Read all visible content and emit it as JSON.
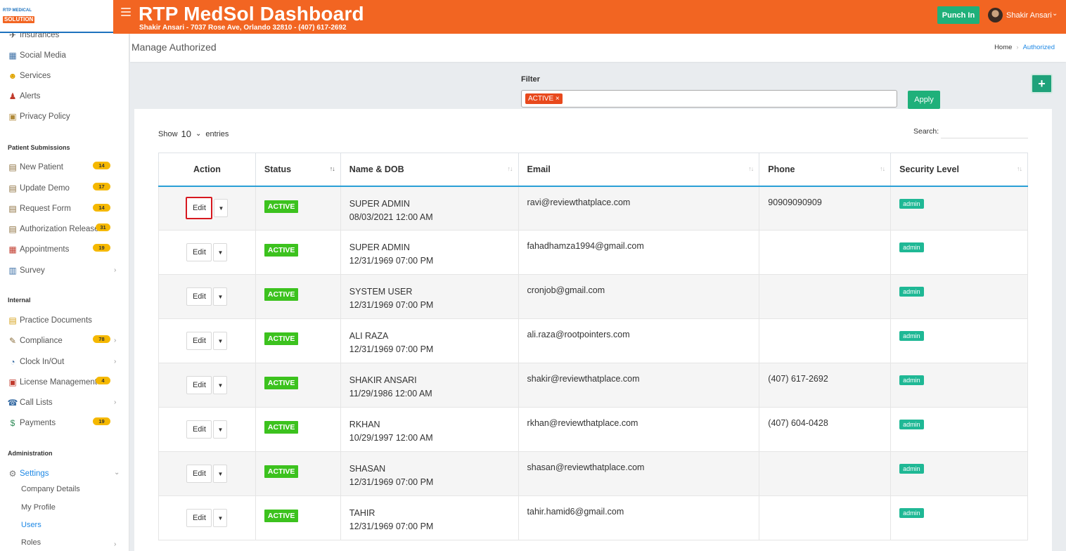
{
  "logo": {
    "line1": "RTP MEDICAL",
    "line2": "SOLUTION"
  },
  "header": {
    "title": "RTP MedSol Dashboard",
    "subtitle": "Shakir Ansari - 7037 Rose Ave, Orlando 32810 - (407) 617-2692",
    "punch_label": "Punch In",
    "user_name": "Shakir Ansari"
  },
  "sidebar": {
    "items": [
      {
        "label": "Insurances",
        "icon": "insurance-icon",
        "glyph": "✈"
      },
      {
        "label": "Social Media",
        "icon": "social-media-icon",
        "glyph": "▦"
      },
      {
        "label": "Services",
        "icon": "services-icon",
        "glyph": "☻"
      },
      {
        "label": "Alerts",
        "icon": "alerts-icon",
        "glyph": "♟"
      },
      {
        "label": "Privacy Policy",
        "icon": "privacy-icon",
        "glyph": "▣"
      }
    ],
    "section_patient": "Patient Submissions",
    "patient_items": [
      {
        "label": "New Patient",
        "badge": "14"
      },
      {
        "label": "Update Demo",
        "badge": "17"
      },
      {
        "label": "Request Form",
        "badge": "14"
      },
      {
        "label": "Authorization Release",
        "badge": "31"
      },
      {
        "label": "Appointments",
        "badge": "19"
      },
      {
        "label": "Survey",
        "badge": ""
      }
    ],
    "section_internal": "Internal",
    "internal_items": [
      {
        "label": "Practice Documents",
        "badge": ""
      },
      {
        "label": "Compliance",
        "badge": "78"
      },
      {
        "label": "Clock In/Out",
        "badge": ""
      },
      {
        "label": "License Management",
        "badge": "4"
      },
      {
        "label": "Call Lists",
        "badge": ""
      },
      {
        "label": "Payments",
        "badge": "19"
      }
    ],
    "section_admin": "Administration",
    "settings_label": "Settings",
    "settings_sub": [
      "Company Details",
      "My Profile",
      "Users",
      "Roles"
    ]
  },
  "page": {
    "title": "Manage Authorized",
    "breadcrumb_home": "Home",
    "breadcrumb_current": "Authorized"
  },
  "filter": {
    "label": "Filter",
    "tag": "ACTIVE ×",
    "apply_label": "Apply",
    "add_label": "+"
  },
  "table_controls": {
    "show_label": "Show",
    "page_size": "10",
    "entries_label": "entries",
    "search_label": "Search:"
  },
  "table": {
    "columns": [
      "Action",
      "Status",
      "Name & DOB",
      "Email",
      "Phone",
      "Security Level"
    ],
    "sort_glyph": "↑↓",
    "edit_label": "Edit",
    "drop_glyph": "▼",
    "rows": [
      {
        "status": "ACTIVE",
        "name": "SUPER ADMIN",
        "dob": "08/03/2021 12:00 AM",
        "email": "ravi@reviewthatplace.com",
        "phone": "90909090909",
        "level": "admin"
      },
      {
        "status": "ACTIVE",
        "name": "SUPER ADMIN",
        "dob": "12/31/1969 07:00 PM",
        "email": "fahadhamza1994@gmail.com",
        "phone": "",
        "level": "admin"
      },
      {
        "status": "ACTIVE",
        "name": "SYSTEM USER",
        "dob": "12/31/1969 07:00 PM",
        "email": "cronjob@gmail.com",
        "phone": "",
        "level": "admin"
      },
      {
        "status": "ACTIVE",
        "name": "ALI RAZA",
        "dob": "12/31/1969 07:00 PM",
        "email": "ali.raza@rootpointers.com",
        "phone": "",
        "level": "admin"
      },
      {
        "status": "ACTIVE",
        "name": "SHAKIR ANSARI",
        "dob": "11/29/1986 12:00 AM",
        "email": "shakir@reviewthatplace.com",
        "phone": "(407) 617-2692",
        "level": "admin"
      },
      {
        "status": "ACTIVE",
        "name": "RKHAN",
        "dob": "10/29/1997 12:00 AM",
        "email": "rkhan@reviewthatplace.com",
        "phone": "(407) 604-0428",
        "level": "admin"
      },
      {
        "status": "ACTIVE",
        "name": "SHASAN",
        "dob": "12/31/1969 07:00 PM",
        "email": "shasan@reviewthatplace.com",
        "phone": "",
        "level": "admin"
      },
      {
        "status": "ACTIVE",
        "name": "TAHIR",
        "dob": "12/31/1969 07:00 PM",
        "email": "tahir.hamid6@gmail.com",
        "phone": "",
        "level": "admin"
      }
    ]
  },
  "colors": {
    "header": "#f26522",
    "accent": "#1fb07a",
    "active": "#3cc21e",
    "link": "#1e88e5"
  }
}
